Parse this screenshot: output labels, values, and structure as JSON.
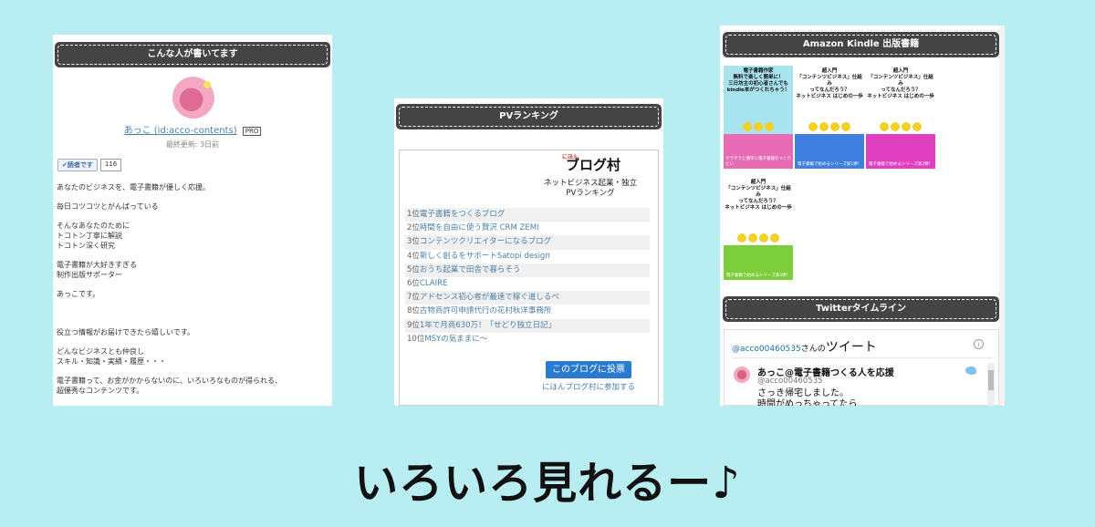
{
  "left_panel": {
    "title": "こんな人が書いてます",
    "author_name": "あっこ (id:acco-contents)",
    "pro_badge": "PRO",
    "updated": "最終更新: 3日前",
    "reader_button": "✔読者です",
    "reader_count": "116",
    "paragraphs": [
      "あなたのビジネスを、電子書籍が優しく応援。",
      "毎日コツコツとがんばっている",
      "そんなあなたのために\nトコトン丁寧に解説\nトコトン深く研究",
      "電子書籍が大好きすぎる\n制作出版サポーター",
      "あっこです。",
      "",
      "役立つ情報がお届けできたら嬉しいです。",
      "どんなビジネスとも仲良し\nスキル・知識・実績・履歴・・・",
      "電子書籍って、お金がかからないのに、いろいろなものが得られる、\n超優秀なコンテンツです。"
    ]
  },
  "mid_panel": {
    "title": "PVランキング",
    "logo_small": "にほん",
    "logo": "ブログ村",
    "subtitle": "ネットビジネス起業・独立\nPVランキング",
    "rankings": [
      {
        "rank": "1位",
        "title": "電子書籍をつくるブログ"
      },
      {
        "rank": "2位",
        "title": "時間を自由に使う賢沢 CRM ZEMI"
      },
      {
        "rank": "3位",
        "title": "コンテンツクリエイターになるブログ"
      },
      {
        "rank": "4位",
        "title": "新しく創るをサポートSatopi design"
      },
      {
        "rank": "5位",
        "title": "おうち起業で田舎で暮らそう"
      },
      {
        "rank": "6位",
        "title": "CLAIRE"
      },
      {
        "rank": "7位",
        "title": "アドセンス初心者が最速で稼ぐ道しるべ"
      },
      {
        "rank": "8位",
        "title": "古物商許可申請代行の花村秋洋事務所"
      },
      {
        "rank": "9位",
        "title": "1年で月商630万！「せどり独立日記」"
      },
      {
        "rank": "10位",
        "title": "MSYの気ままに〜"
      }
    ],
    "vote_button": "このブログに投票",
    "join_link": "にほんブログ村に参加する"
  },
  "right_panel": {
    "kindle_title": "Amazon Kindle 出版書籍",
    "covers": [
      {
        "top": "電子書籍作家\n無料で楽しく簡単に！\n三日坊主の初心者さんでも\nkindle本がつくれちゃう！",
        "bottom": "サラサラと簡単に電子書籍をつくりたい",
        "bg": "#a8e3f0",
        "bot_bg": "#e86bb5"
      },
      {
        "top": "超入門\n「コンテンツビジネス」仕組み\nってなんだろう？\nネットビジネス はじめの一歩",
        "bottom": "電子書籍で始めるシリーズ第1弾！",
        "bg": "#ffffff",
        "bot_bg": "#3f7fe0"
      },
      {
        "top": "超入門\n「コンテンツビジネス」仕組み\nってなんだろう？\nネットビジネス はじめの一歩",
        "bottom": "電子書籍で始めるシリーズ第2弾！",
        "bg": "#ffffff",
        "bot_bg": "#e040c0"
      },
      {
        "top": "超入門\n「コンテンツビジネス」仕組み\nってなんだろう？\nネットビジネス はじめの一歩",
        "bottom": "電子書籍で始めるシリーズ第3弾！",
        "bg": "#ffffff",
        "bot_bg": "#7ccf3a"
      }
    ],
    "twitter_title": "Twitterタイムライン",
    "twitter_handle": "@acco00460535",
    "twitter_suffix": "さんの",
    "twitter_big": "ツイート",
    "tweet_name": "あっこ@電子書籍つくる人を応援",
    "tweet_id": "@acco00460535",
    "tweet_text": "さっき帰宅しました。\n時間がめっちゃってたら"
  },
  "headline": "いろいろ見れるー♪"
}
